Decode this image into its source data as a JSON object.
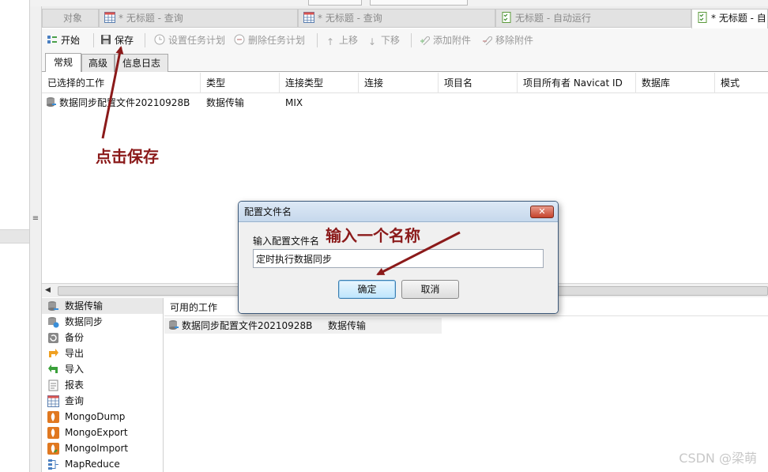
{
  "tabs": [
    {
      "label": "对象",
      "active": false
    },
    {
      "label": "* 无标题 - 查询",
      "active": false
    },
    {
      "label": "* 无标题 - 查询",
      "active": false
    },
    {
      "label": "无标题 - 自动运行",
      "active": false
    },
    {
      "label": "* 无标题 - 自",
      "active": true
    }
  ],
  "toolbar": {
    "start": "开始",
    "save": "保存",
    "set_schedule": "设置任务计划",
    "delete_schedule": "删除任务计划",
    "move_up": "上移",
    "move_down": "下移",
    "add_attachment": "添加附件",
    "remove_attachment": "移除附件"
  },
  "subtabs": [
    {
      "label": "常规",
      "active": true
    },
    {
      "label": "高级",
      "active": false
    },
    {
      "label": "信息日志",
      "active": false
    }
  ],
  "grid": {
    "columns": [
      "已选择的工作",
      "类型",
      "连接类型",
      "连接",
      "项目名",
      "项目所有者 Navicat ID",
      "数据库",
      "模式"
    ],
    "rows": [
      [
        "数据同步配置文件20210928B",
        "数据传输",
        "MIX",
        "",
        "",
        "",
        "",
        ""
      ]
    ]
  },
  "job_types": [
    "数据传输",
    "数据同步",
    "备份",
    "导出",
    "导入",
    "报表",
    "查询",
    "MongoDump",
    "MongoExport",
    "MongoImport",
    "MapReduce"
  ],
  "available": {
    "header": "可用的工作",
    "rows": [
      [
        "数据同步配置文件20210928B",
        "数据传输"
      ]
    ]
  },
  "dialog": {
    "title": "配置文件名",
    "label": "输入配置文件名",
    "value": "定时执行数据同步",
    "ok": "确定",
    "cancel": "取消"
  },
  "annotations": {
    "save_hint": "点击保存",
    "name_hint": "输入一个名称",
    "color": "#8b1a1a"
  },
  "watermark": "CSDN @梁萌"
}
